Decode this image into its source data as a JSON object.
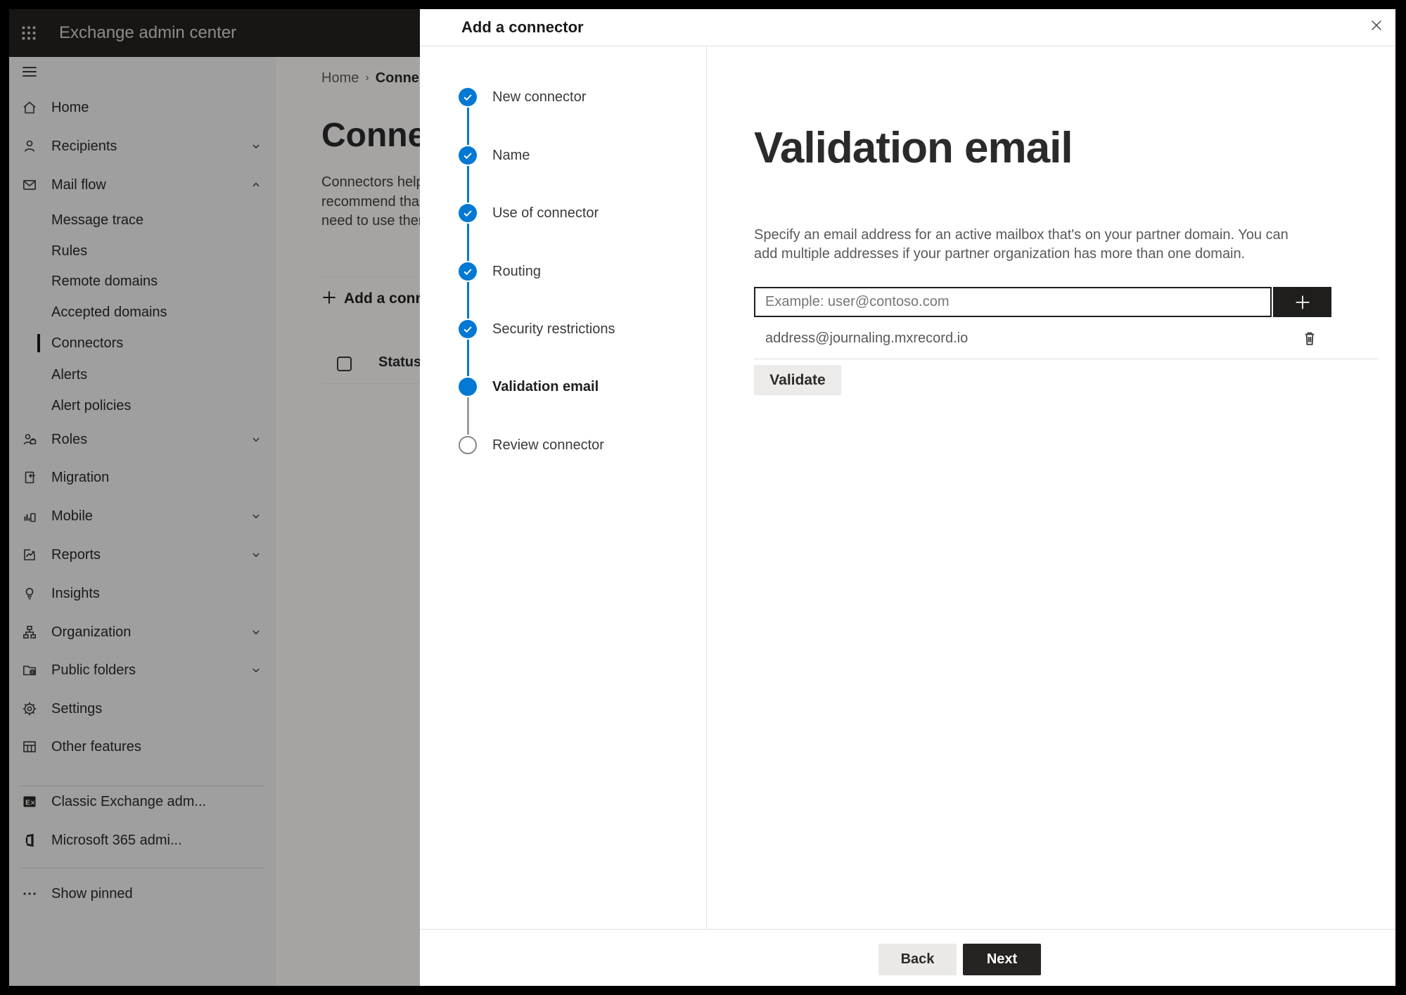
{
  "colors": {
    "accent_blue": "#0078d4",
    "topbar_bg": "#232221",
    "sidebar_bg": "#f3f2f1",
    "dark_button": "#252423",
    "text_primary": "#323130",
    "text_secondary": "#605e5c"
  },
  "topbar": {
    "title": "Exchange admin center",
    "app_launcher_icon": "app-grid-icon"
  },
  "sidebar": {
    "hamburger_icon": "hamburger-icon",
    "items": [
      {
        "label": "Home",
        "icon": "home-icon"
      },
      {
        "label": "Recipients",
        "icon": "person-icon",
        "chevron": "down"
      },
      {
        "label": "Mail flow",
        "icon": "mail-icon",
        "chevron": "up"
      },
      {
        "label": "Message trace",
        "indent": true
      },
      {
        "label": "Rules",
        "indent": true
      },
      {
        "label": "Remote domains",
        "indent": true
      },
      {
        "label": "Accepted domains",
        "indent": true
      },
      {
        "label": "Connectors",
        "indent": true,
        "selected": true
      },
      {
        "label": "Alerts",
        "indent": true
      },
      {
        "label": "Alert policies",
        "indent": true
      },
      {
        "label": "Roles",
        "icon": "roles-icon",
        "chevron": "down"
      },
      {
        "label": "Migration",
        "icon": "migration-icon"
      },
      {
        "label": "Mobile",
        "icon": "mobile-icon",
        "chevron": "down"
      },
      {
        "label": "Reports",
        "icon": "reports-icon",
        "chevron": "down"
      },
      {
        "label": "Insights",
        "icon": "lightbulb-icon"
      },
      {
        "label": "Organization",
        "icon": "org-icon",
        "chevron": "down"
      },
      {
        "label": "Public folders",
        "icon": "folder-globe-icon",
        "chevron": "down"
      },
      {
        "label": "Settings",
        "icon": "gear-icon"
      },
      {
        "label": "Other features",
        "icon": "table-icon"
      },
      {
        "divider": true
      },
      {
        "label": "Classic Exchange adm...",
        "icon": "exchange-logo-icon"
      },
      {
        "label": "Microsoft 365 admi...",
        "icon": "m365-logo-icon"
      },
      {
        "divider": true
      },
      {
        "label": "Show pinned",
        "icon": "ellipsis-icon"
      }
    ]
  },
  "page": {
    "breadcrumb": {
      "home": "Home",
      "separator": "›",
      "current": "Conne"
    },
    "heading_fragment": "Connec",
    "paragraph_lines": [
      "Connectors help",
      "recommend tha",
      "need to use ther"
    ],
    "add_button_label": "Add a conn",
    "add_button_icon": "plus-icon",
    "table": {
      "select_all_checkbox": "",
      "status_header": "Status"
    }
  },
  "modal": {
    "title": "Add a connector",
    "close_icon": "close-icon",
    "steps": [
      {
        "label": "New connector",
        "state": "done"
      },
      {
        "label": "Name",
        "state": "done"
      },
      {
        "label": "Use of connector",
        "state": "done"
      },
      {
        "label": "Routing",
        "state": "done"
      },
      {
        "label": "Security restrictions",
        "state": "done"
      },
      {
        "label": "Validation email",
        "state": "current"
      },
      {
        "label": "Review connector",
        "state": "upcoming"
      }
    ],
    "content": {
      "heading": "Validation email",
      "description": "Specify an email address for an active mailbox that's on your partner domain. You can add multiple addresses if your partner organization has more than one domain.",
      "input_placeholder": "Example: user@contoso.com",
      "add_address_icon": "plus-icon",
      "addresses": [
        {
          "email": "address@journaling.mxrecord.io",
          "delete_icon": "trash-icon"
        }
      ],
      "validate_button": "Validate"
    },
    "footer": {
      "back": "Back",
      "next": "Next"
    }
  }
}
